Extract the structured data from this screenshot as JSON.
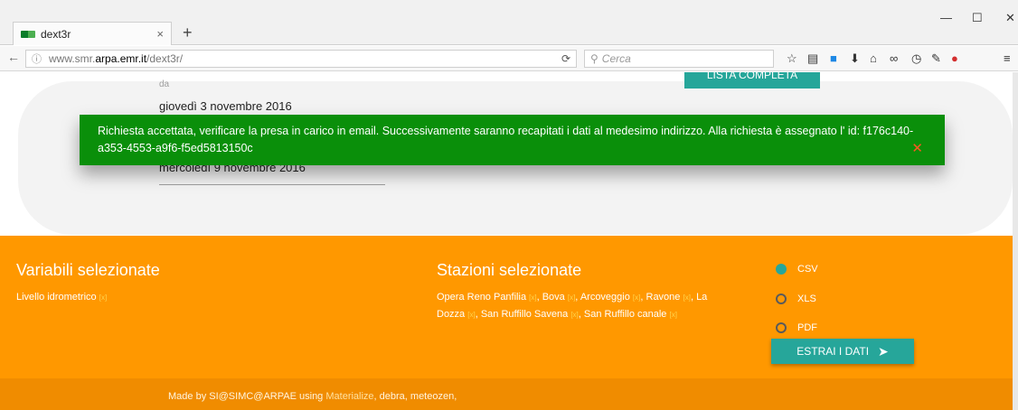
{
  "browser": {
    "tab_title": "dext3r",
    "tab_close": "×",
    "new_tab": "+",
    "url_info": "ⓘ",
    "url_prefix": "www.smr.",
    "url_host": "arpa.emr.it",
    "url_path": "/dext3r/",
    "search_placeholder": "Cerca",
    "minimize": "—",
    "maximize": "☐",
    "close": "✕"
  },
  "filters": {
    "from_label": "da",
    "from_date": "giovedì 3 novembre 2016",
    "to_date": "mercoledì 9 novembre 2016",
    "list_button": "LISTA COMPLETA"
  },
  "toast": {
    "message": "Richiesta accettata, verificare la presa in carico in email. Successivamente saranno recapitati i dati al medesimo indirizzo. Alla richiesta è assegnato l' id: f176c140-a353-4553-a9f6-f5ed5813150c",
    "close": "✕"
  },
  "summary": {
    "variables_title": "Variabili selezionate",
    "variables": [
      {
        "name": "Livello idrometrico",
        "remove": "[x]"
      }
    ],
    "stations_title": "Stazioni selezionate",
    "stations": [
      {
        "name": "Opera Reno Panfilia",
        "remove": "[x]"
      },
      {
        "name": "Bova",
        "remove": "[x]"
      },
      {
        "name": "Arcoveggio",
        "remove": "[x]"
      },
      {
        "name": "Ravone",
        "remove": "[x]"
      },
      {
        "name": "La Dozza",
        "remove": "[x]"
      },
      {
        "name": "San Ruffillo Savena",
        "remove": "[x]"
      },
      {
        "name": "San Ruffillo canale",
        "remove": "[x]"
      }
    ]
  },
  "format": {
    "options": [
      "CSV",
      "XLS",
      "PDF"
    ],
    "selected": "CSV"
  },
  "extract_button": "ESTRAI I DATI",
  "footer": {
    "prefix": "Made by SI@SIMC@ARPAE using ",
    "link": "Materialize",
    "suffix": ", debra, meteozen,"
  },
  "colors": {
    "accent": "#26a69a",
    "orange": "#ff9800",
    "toast": "#0a8f0a"
  }
}
